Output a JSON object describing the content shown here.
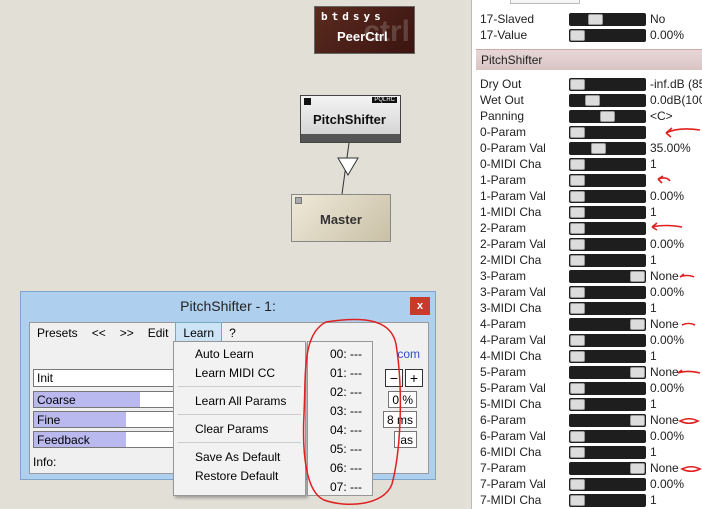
{
  "canvas": {
    "nodes": {
      "peer": {
        "brand": "btdsys",
        "bg": "ctrl",
        "name": "PeerCtrl"
      },
      "pitch": {
        "name": "PitchShifter",
        "tag": "PQLRC"
      },
      "master": {
        "name": "Master"
      }
    }
  },
  "plugin_window": {
    "title": "PitchShifter - 1:",
    "close": "x",
    "menu": [
      "Presets",
      "<<",
      ">>",
      "Edit",
      "Learn",
      "?"
    ],
    "link_fragment": "com",
    "preset_name": "Init",
    "params": [
      {
        "label": "Coarse",
        "value": "0 %",
        "fill": 0.76
      },
      {
        "label": "Fine",
        "value": "8 ms",
        "fill": 0.66
      },
      {
        "label": "Feedback",
        "value": "ias",
        "fill": 0.66
      }
    ],
    "minus": "−",
    "plus": "+",
    "info_label": "Info:"
  },
  "learn_menu": {
    "items": [
      "Auto Learn",
      "Learn MIDI CC",
      "Learn All Params",
      "Clear Params",
      "Save As Default",
      "Restore Default"
    ],
    "slots": [
      "00: ---",
      "01: ---",
      "02: ---",
      "03: ---",
      "04: ---",
      "05: ---",
      "06: ---",
      "07: ---"
    ]
  },
  "right_panel": {
    "section": "PitchShifter",
    "top_rows": [
      {
        "label": "17-Slaved",
        "value": "No",
        "pos": 0.3
      },
      {
        "label": "17-Value",
        "value": "0.00%",
        "pos": 0.0
      }
    ],
    "rows": [
      {
        "label": "Dry Out",
        "value": "-inf.dB (85",
        "pos": 0.0
      },
      {
        "label": "Wet Out",
        "value": "0.0dB(100",
        "pos": 0.25
      },
      {
        "label": "Panning",
        "value": "<C>",
        "pos": 0.5
      },
      {
        "label": "0-Param",
        "value": "",
        "pos": 0.0
      },
      {
        "label": "0-Param Val",
        "value": "35.00%",
        "pos": 0.35
      },
      {
        "label": "0-MIDI Cha",
        "value": "1",
        "pos": 0.0
      },
      {
        "label": "1-Param",
        "value": "",
        "pos": 0.0
      },
      {
        "label": "1-Param Val",
        "value": "0.00%",
        "pos": 0.0
      },
      {
        "label": "1-MIDI Cha",
        "value": "1",
        "pos": 0.0
      },
      {
        "label": "2-Param",
        "value": "",
        "pos": 0.0
      },
      {
        "label": "2-Param Val",
        "value": "0.00%",
        "pos": 0.0
      },
      {
        "label": "2-MIDI Cha",
        "value": "1",
        "pos": 0.0
      },
      {
        "label": "3-Param",
        "value": "None",
        "pos": 1.0
      },
      {
        "label": "3-Param Val",
        "value": "0.00%",
        "pos": 0.0
      },
      {
        "label": "3-MIDI Cha",
        "value": "1",
        "pos": 0.0
      },
      {
        "label": "4-Param",
        "value": "None",
        "pos": 1.0
      },
      {
        "label": "4-Param Val",
        "value": "0.00%",
        "pos": 0.0
      },
      {
        "label": "4-MIDI Cha",
        "value": "1",
        "pos": 0.0
      },
      {
        "label": "5-Param",
        "value": "None",
        "pos": 1.0
      },
      {
        "label": "5-Param Val",
        "value": "0.00%",
        "pos": 0.0
      },
      {
        "label": "5-MIDI Cha",
        "value": "1",
        "pos": 0.0
      },
      {
        "label": "6-Param",
        "value": "None",
        "pos": 1.0
      },
      {
        "label": "6-Param Val",
        "value": "0.00%",
        "pos": 0.0
      },
      {
        "label": "6-MIDI Cha",
        "value": "1",
        "pos": 0.0
      },
      {
        "label": "7-Param",
        "value": "None",
        "pos": 1.0
      },
      {
        "label": "7-Param Val",
        "value": "0.00%",
        "pos": 0.0
      },
      {
        "label": "7-MIDI Cha",
        "value": "1",
        "pos": 0.0
      }
    ]
  },
  "colors": {
    "annotation": "#e02020",
    "section_header": "#dccaca",
    "window_frame": "#aed0ee",
    "slider_track": "#1e1e1e"
  }
}
